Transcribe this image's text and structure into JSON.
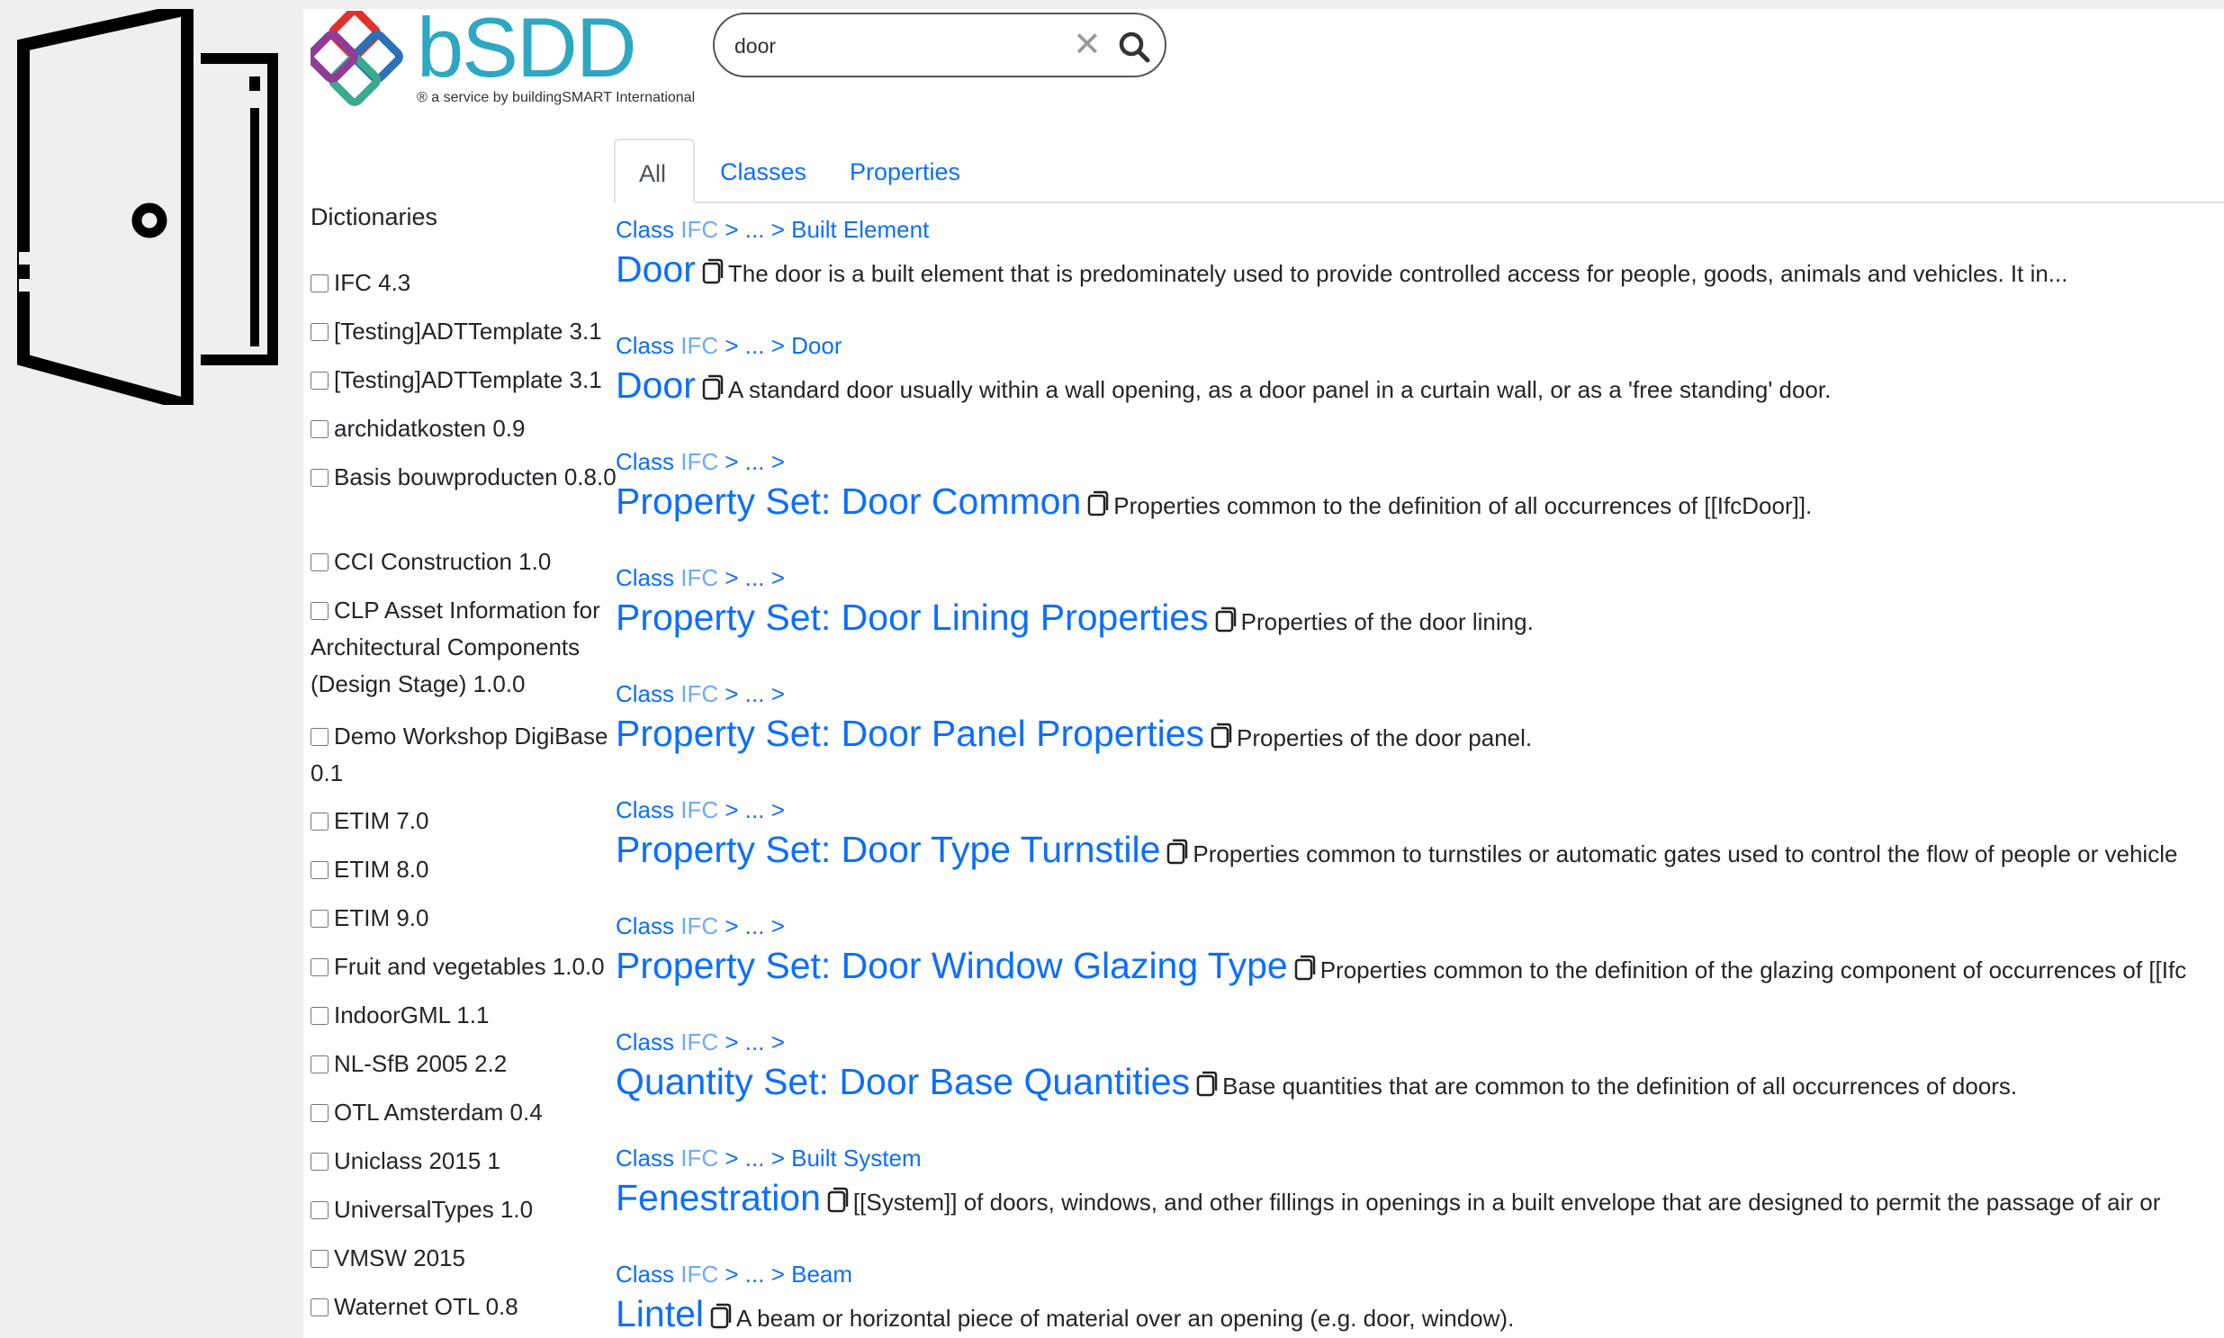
{
  "logo": {
    "name": "bSDD",
    "tagline": "a service by buildingSMART International"
  },
  "search": {
    "value": "door",
    "clear_glyph": "✕",
    "icon": "search-icon"
  },
  "tabs": [
    {
      "label": "All",
      "active": true
    },
    {
      "label": "Classes",
      "active": false
    },
    {
      "label": "Properties",
      "active": false
    }
  ],
  "sidebar": {
    "title": "Dictionaries",
    "items": [
      "IFC 4.3",
      "[Testing]ADTTemplate 3.1",
      "[Testing]ADTTemplate 3.1",
      "archidatkosten 0.9",
      "Basis bouwproducten 0.8.0",
      "CCI Construction 1.0",
      "CLP Asset Information for Architectural Components (Design Stage) 1.0.0",
      "Demo Workshop DigiBase 0.1",
      "ETIM 7.0",
      "ETIM 8.0",
      "ETIM 9.0",
      "Fruit and vegetables 1.0.0",
      "IndoorGML 1.1",
      "NL-SfB 2005 2.2",
      "OTL Amsterdam 0.4",
      "Uniclass 2015 1",
      "UniversalTypes 1.0",
      "VMSW 2015",
      "Waternet OTL 0.8"
    ]
  },
  "results": [
    {
      "crumb": [
        "Class",
        "IFC",
        ">",
        "...",
        ">",
        "Built Element"
      ],
      "title": "Door",
      "desc": "The door is a built element that is predominately used to provide controlled access for people, goods, animals and vehicles. It in..."
    },
    {
      "crumb": [
        "Class",
        "IFC",
        ">",
        "...",
        ">",
        "Door"
      ],
      "title": "Door",
      "desc": "A standard door usually within a wall opening, as a door panel in a curtain wall, or as a 'free standing' door."
    },
    {
      "crumb": [
        "Class",
        "IFC",
        ">",
        "...",
        ">",
        ""
      ],
      "title": "Property Set: Door Common",
      "desc": "Properties common to the definition of all occurrences of [[IfcDoor]]."
    },
    {
      "crumb": [
        "Class",
        "IFC",
        ">",
        "...",
        ">",
        ""
      ],
      "title": "Property Set: Door Lining Properties",
      "desc": "Properties of the door lining."
    },
    {
      "crumb": [
        "Class",
        "IFC",
        ">",
        "...",
        ">",
        ""
      ],
      "title": "Property Set: Door Panel Properties",
      "desc": "Properties of the door panel."
    },
    {
      "crumb": [
        "Class",
        "IFC",
        ">",
        "...",
        ">",
        ""
      ],
      "title": "Property Set: Door Type Turnstile",
      "desc": "Properties common to turnstiles or automatic gates used to control the flow of people or vehicle"
    },
    {
      "crumb": [
        "Class",
        "IFC",
        ">",
        "...",
        ">",
        ""
      ],
      "title": "Property Set: Door Window Glazing Type",
      "desc": "Properties common to the definition of the glazing component of occurrences of [[Ifc"
    },
    {
      "crumb": [
        "Class",
        "IFC",
        ">",
        "...",
        ">",
        ""
      ],
      "title": "Quantity Set: Door Base Quantities",
      "desc": "Base quantities that are common to the definition of all occurrences of doors."
    },
    {
      "crumb": [
        "Class",
        "IFC",
        ">",
        "...",
        ">",
        "Built System"
      ],
      "title": "Fenestration",
      "desc": "[[System]] of doors, windows, and other fillings in openings in a built envelope that are designed to permit the passage of air or"
    },
    {
      "crumb": [
        "Class",
        "IFC",
        ">",
        "...",
        ">",
        "Beam"
      ],
      "title": "Lintel",
      "desc": "A beam or horizontal piece of material over an opening (e.g. door, window)."
    }
  ]
}
